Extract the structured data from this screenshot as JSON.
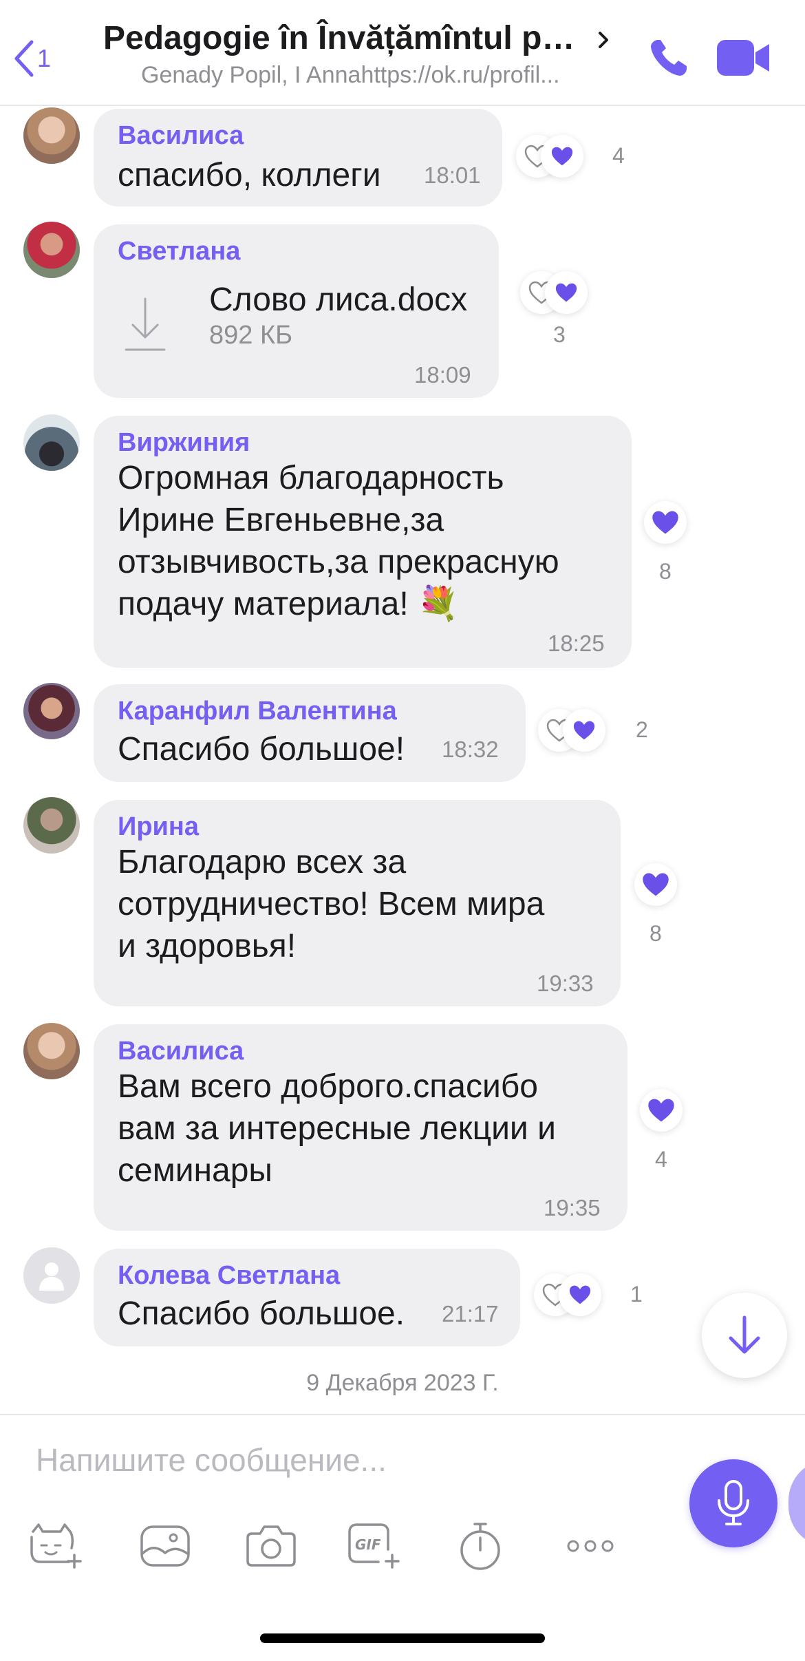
{
  "header": {
    "back_count": "1",
    "title": "Pedagogie în Învățămîntul pri...",
    "subtitle": "Genady Popil, I Annahttps://ok.ru/profil..."
  },
  "messages": [
    {
      "sender": "Василиса",
      "text": "спасибо, коллеги",
      "time": "18:01",
      "reactions": "4"
    },
    {
      "sender": "Светлана",
      "file_name": "Слово лиса.docx",
      "file_size": "892 КБ",
      "time": "18:09",
      "reactions": "3"
    },
    {
      "sender": "Виржиния",
      "text": "Огромная благодарность\nИрине Евгеньевне,за\nотзывчивость,за прекрасную\nподачу материала! 💐",
      "time": "18:25",
      "reactions": "8"
    },
    {
      "sender": "Каранфил Валентина",
      "text": "Спасибо большое!",
      "time": "18:32",
      "reactions": "2"
    },
    {
      "sender": "Ирина",
      "text": "Благодарю всех за\nсотрудничество! Всем мира\nи здоровья!",
      "time": "19:33",
      "reactions": "8"
    },
    {
      "sender": "Василиса",
      "text": "Вам всего доброго.спасибо\nвам за интересные лекции и\nсеминары",
      "time": "19:35",
      "reactions": "4"
    },
    {
      "sender": "Колева Светлана",
      "text": "Спасибо большое.",
      "time": "21:17",
      "reactions": "1"
    }
  ],
  "date_separator": "9 Декабря 2023 Г.",
  "composer": {
    "placeholder": "Напишите сообщение..."
  },
  "colors": {
    "accent": "#7360f2",
    "bubble": "#efeff1",
    "muted": "#8e8e93"
  },
  "icons": [
    "back-chevron-icon",
    "chevron-right-icon",
    "phone-icon",
    "video-camera-icon",
    "heart-outline-icon",
    "heart-filled-icon",
    "download-icon",
    "arrow-down-icon",
    "microphone-icon",
    "sticker-icon",
    "image-icon",
    "camera-icon",
    "gif-icon",
    "timer-icon",
    "more-icon"
  ]
}
